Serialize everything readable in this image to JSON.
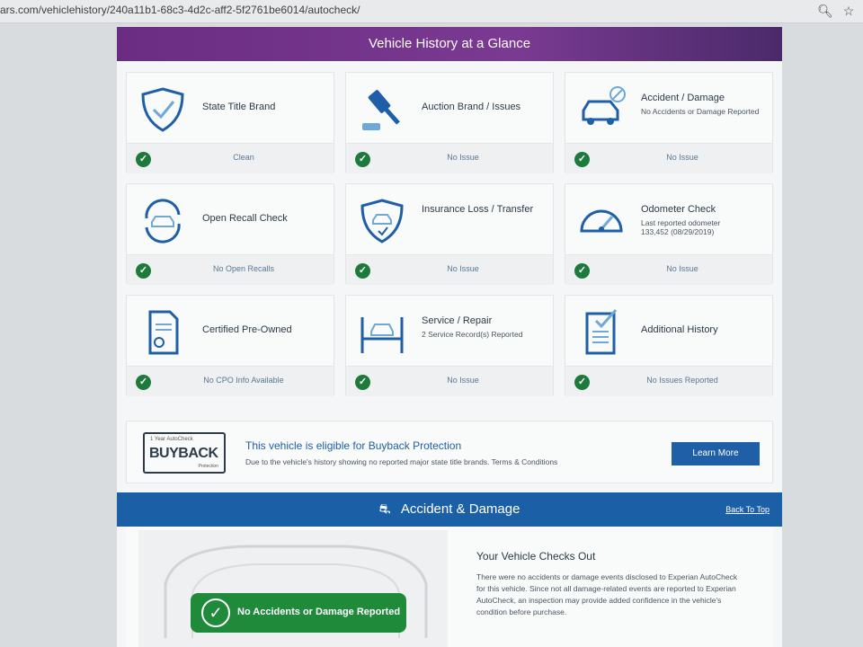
{
  "browser": {
    "url": "ars.com/vehiclehistory/240a11b1-68c3-4d2c-aff2-5f2761be6014/autocheck/"
  },
  "glance": {
    "title": "Vehicle History at a Glance",
    "cells": [
      {
        "title": "State Title Brand",
        "status": "Clean",
        "icon": "shield-check-icon"
      },
      {
        "title": "Auction Brand / Issues",
        "status": "No Issue",
        "icon": "gavel-icon"
      },
      {
        "title": "Accident / Damage",
        "sub": "No Accidents or Damage Reported",
        "status": "No Issue",
        "icon": "car-damage-icon"
      },
      {
        "title": "Open Recall Check",
        "status": "No Open Recalls",
        "icon": "recall-icon"
      },
      {
        "title": "Insurance Loss / Transfer",
        "status": "No Issue",
        "icon": "insurance-shield-icon"
      },
      {
        "title": "Odometer Check",
        "sub": "Last reported odometer",
        "sub2": "133,452 (08/29/2019)",
        "status": "No Issue",
        "icon": "odometer-icon"
      },
      {
        "title": "Certified Pre-Owned",
        "status": "No CPO Info Available",
        "icon": "certificate-icon"
      },
      {
        "title": "Service / Repair",
        "sub": "2 Service Record(s) Reported",
        "status": "No Issue",
        "icon": "car-lift-icon"
      },
      {
        "title": "Additional History",
        "status": "No Issues Reported",
        "icon": "checklist-icon"
      }
    ]
  },
  "buyback": {
    "badge_small": "1 Year AutoCheck",
    "badge_big": "BUYBACK",
    "badge_prot": "Protection",
    "title": "This vehicle is eligible for Buyback Protection",
    "text": "Due to the vehicle's history showing no reported major state title brands. Terms & Conditions",
    "button": "Learn More"
  },
  "accident": {
    "title": "Accident & Damage",
    "back_to_top": "Back To Top",
    "badge": "No Accidents or Damage Reported",
    "checks_title": "Your Vehicle Checks Out",
    "checks_text": "There were no accidents or damage events disclosed to Experian AutoCheck for this vehicle. Since not all damage-related events are reported to Experian AutoCheck, an inspection may provide added confidence in the vehicle's condition before purchase."
  }
}
